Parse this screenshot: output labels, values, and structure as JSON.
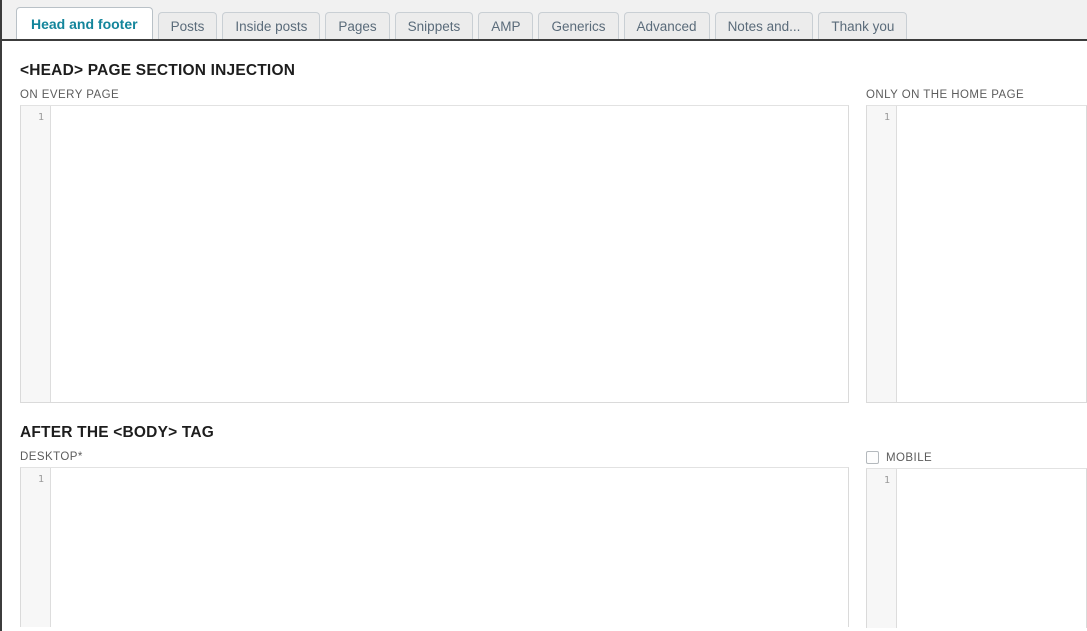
{
  "tabs": [
    {
      "label": "Head and footer",
      "active": true
    },
    {
      "label": "Posts",
      "active": false
    },
    {
      "label": "Inside posts",
      "active": false
    },
    {
      "label": "Pages",
      "active": false
    },
    {
      "label": "Snippets",
      "active": false
    },
    {
      "label": "AMP",
      "active": false
    },
    {
      "label": "Generics",
      "active": false
    },
    {
      "label": "Advanced",
      "active": false
    },
    {
      "label": "Notes and...",
      "active": false
    },
    {
      "label": "Thank you",
      "active": false
    }
  ],
  "sections": {
    "head": {
      "title": "<HEAD> PAGE SECTION INJECTION",
      "every_page": {
        "label": "ON EVERY PAGE",
        "line_number": "1",
        "value": "",
        "placeholder": ""
      },
      "home_page": {
        "label": "ONLY ON THE HOME PAGE",
        "line_number": "1",
        "value": "",
        "placeholder": ""
      }
    },
    "body": {
      "title": "AFTER THE <BODY> TAG",
      "desktop": {
        "label": "DESKTOP*",
        "line_number": "1",
        "value": "",
        "placeholder": ""
      },
      "mobile": {
        "label": "MOBILE",
        "checkbox_checked": false,
        "line_number": "1",
        "value": "",
        "placeholder": ""
      }
    }
  },
  "colors": {
    "active_tab_text": "#13859b",
    "inactive_tab_text": "#5a6b7a",
    "tabstrip_bg": "#f1f1f1",
    "tabstrip_border": "#3c3c3c",
    "label_text": "#5c5c5c",
    "heading_text": "#1d1d1d",
    "editor_border": "#dadada",
    "gutter_bg": "#f7f7f7"
  }
}
